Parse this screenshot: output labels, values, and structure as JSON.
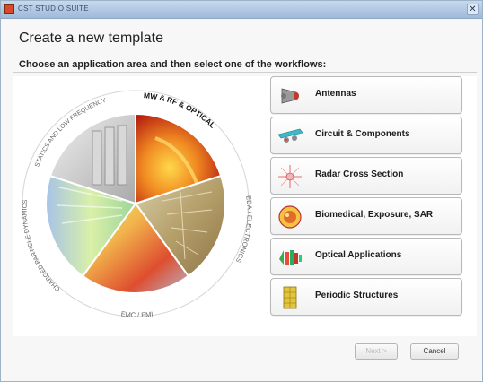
{
  "window": {
    "title": "CST STUDIO SUITE",
    "close_glyph": "✕"
  },
  "dialog": {
    "heading": "Create a new template",
    "subheading": "Choose an application area and then select one of the workflows:"
  },
  "wheel": {
    "segments": [
      {
        "label": "MW & RF & OPTICAL",
        "icon": "mw-rf-optical-image",
        "selected": true
      },
      {
        "label": "EDA / ELECTRONICS",
        "icon": "eda-electronics-image",
        "selected": false
      },
      {
        "label": "EMC / EMI",
        "icon": "emc-emi-image",
        "selected": false
      },
      {
        "label": "CHARGED PARTICLE DYNAMICS",
        "icon": "particle-dynamics-image",
        "selected": false
      },
      {
        "label": "STATICS AND LOW FREQUENCY",
        "icon": "statics-low-frequency-image",
        "selected": false
      }
    ]
  },
  "workflows": [
    {
      "label": "Antennas",
      "icon": "antenna-icon"
    },
    {
      "label": "Circuit & Components",
      "icon": "circuit-components-icon"
    },
    {
      "label": "Radar Cross Section",
      "icon": "radar-cross-section-icon"
    },
    {
      "label": "Biomedical, Exposure, SAR",
      "icon": "biomedical-sar-icon"
    },
    {
      "label": "Optical Applications",
      "icon": "optical-applications-icon"
    },
    {
      "label": "Periodic Structures",
      "icon": "periodic-structures-icon"
    }
  ],
  "footer": {
    "next_label": "Next >",
    "cancel_label": "Cancel",
    "next_enabled": false
  }
}
